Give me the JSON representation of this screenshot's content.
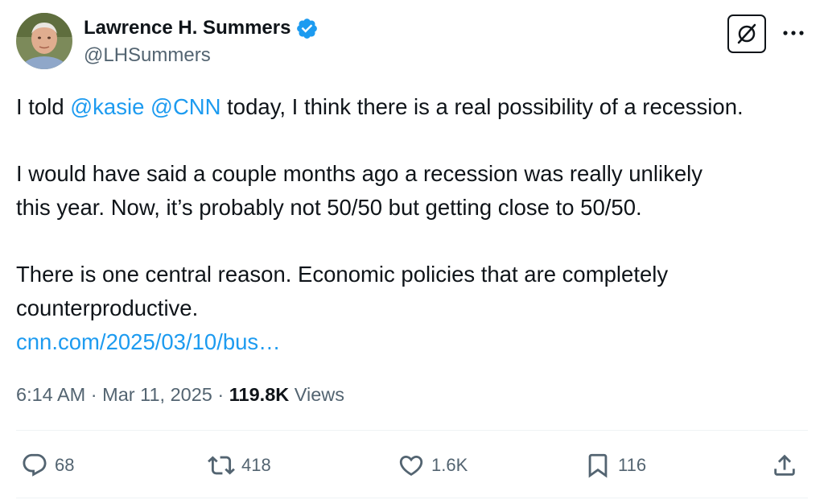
{
  "author": {
    "name": "Lawrence H. Summers",
    "handle": "@LHSummers",
    "verified": true
  },
  "tweet": {
    "line1": {
      "prefix": "I told ",
      "mention1": "@kasie",
      "space": " ",
      "mention2": "@CNN",
      "suffix": " today, I think there is a real possibility of a recession."
    },
    "para2_line1": "I would have said a couple months ago a recession was really unlikely",
    "para2_line2": "this year. Now, it’s probably not 50/50 but getting close to 50/50.",
    "para3_line1": "There is one central reason. Economic policies that are completely",
    "para3_line2": "counterproductive.",
    "link": "cnn.com/2025/03/10/bus…"
  },
  "meta": {
    "time": "6:14 AM",
    "separator": " · ",
    "date": "Mar 11, 2025",
    "views_count": "119.8K",
    "views_label": " Views"
  },
  "actions": {
    "replies": "68",
    "reposts": "418",
    "likes": "1.6K",
    "bookmarks": "116"
  },
  "icons": {
    "verified": "verified-badge-icon",
    "grok": "grok-icon",
    "more": "more-horizontal-icon",
    "reply": "reply-icon",
    "repost": "repost-icon",
    "like": "heart-icon",
    "bookmark": "bookmark-icon",
    "share": "share-icon"
  },
  "colors": {
    "text": "#0f1419",
    "secondary": "#536471",
    "link": "#1d9bf0",
    "verified": "#1d9bf0",
    "divider": "#eff3f4"
  }
}
